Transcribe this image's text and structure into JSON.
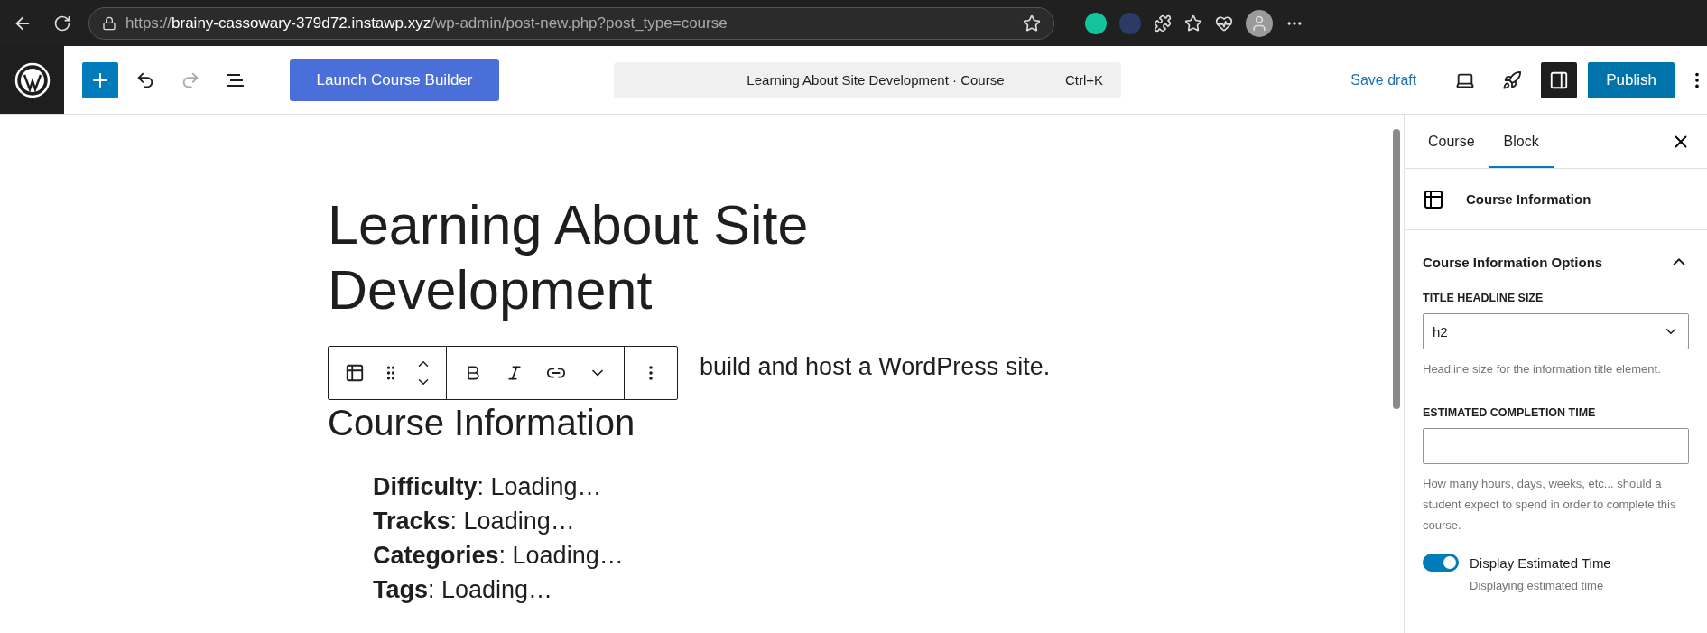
{
  "browser": {
    "url": {
      "scheme": "https://",
      "host": "brainy-cassowary-379d72.instawp.xyz",
      "path": "/wp-admin/post-new.php?post_type=course"
    }
  },
  "toolbar": {
    "launch_button": "Launch Course Builder",
    "command": {
      "title": "Learning About Site Development · Course",
      "shortcut": "Ctrl+K"
    },
    "save_draft": "Save draft",
    "settings_open": true,
    "publish": "Publish"
  },
  "editor": {
    "title": "Learning About Site Development",
    "paragraph": "build and host a WordPress site.",
    "heading": "Course Information",
    "info_items": [
      {
        "label": "Difficulty",
        "value": ": Loading…"
      },
      {
        "label": "Tracks",
        "value": ": Loading…"
      },
      {
        "label": "Categories",
        "value": ": Loading…"
      },
      {
        "label": "Tags",
        "value": ": Loading…"
      }
    ]
  },
  "sidebar": {
    "tabs": [
      {
        "label": "Course",
        "selected": false
      },
      {
        "label": "Block",
        "selected": true
      }
    ],
    "block_name": "Course Information",
    "panel": {
      "title": "Course Information Options",
      "expanded": true
    },
    "fields": [
      {
        "kind": "select",
        "label": "TITLE HEADLINE SIZE",
        "value": "h2",
        "help": "Headline size for the information title element."
      },
      {
        "kind": "text",
        "label": "ESTIMATED COMPLETION TIME",
        "help": "How many hours, days, weeks, etc... should a student expect to spend in order to complete this course."
      }
    ],
    "toggle": {
      "label": "Display Estimated Time",
      "on": true,
      "help": "Displaying estimated time"
    }
  }
}
